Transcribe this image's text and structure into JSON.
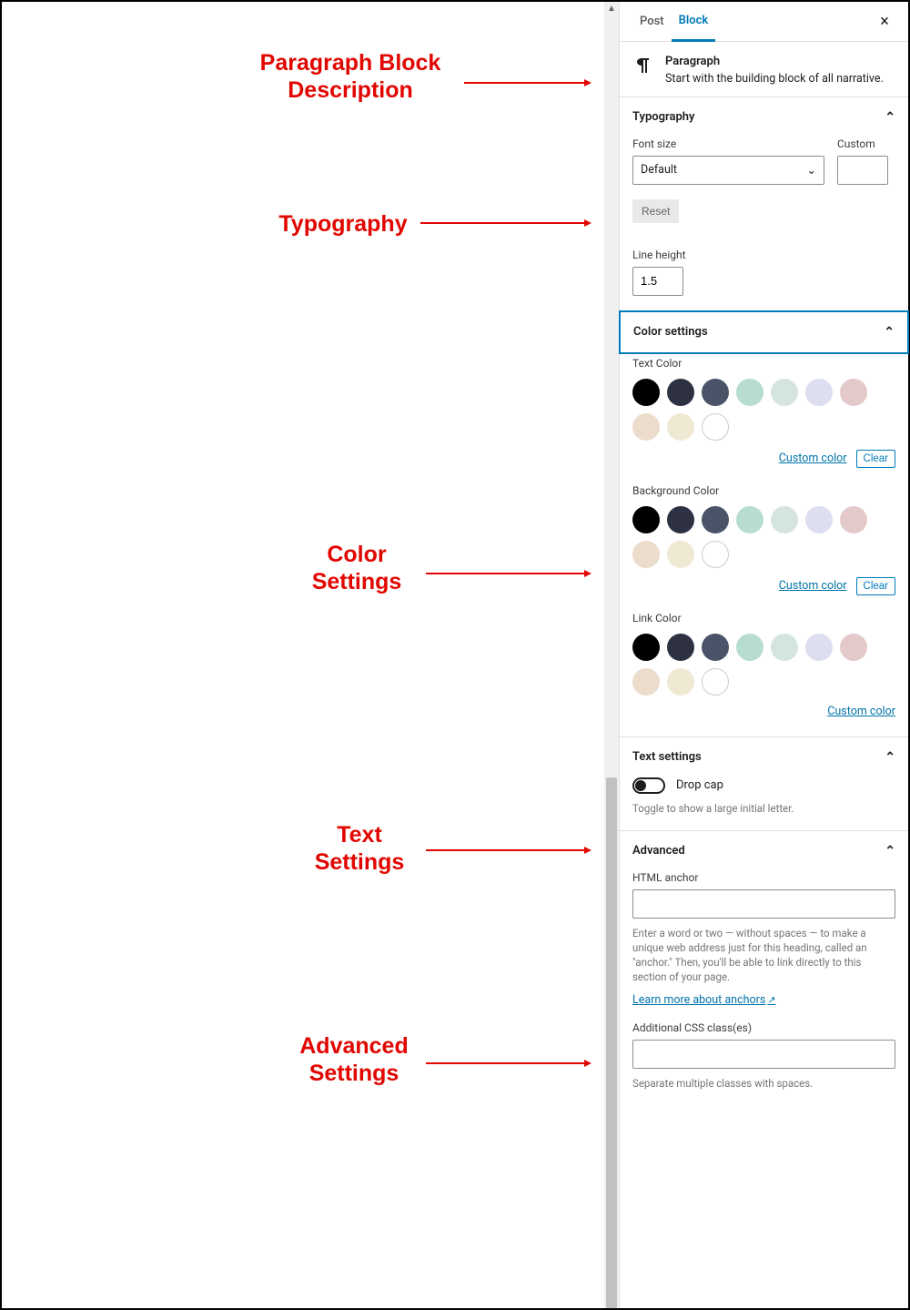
{
  "tabs": {
    "post": "Post",
    "block": "Block",
    "active": "block"
  },
  "block_desc": {
    "title": "Paragraph",
    "text": "Start with the building block of all narrative."
  },
  "typography": {
    "title": "Typography",
    "font_size_label": "Font size",
    "custom_label": "Custom",
    "font_size_value": "Default",
    "custom_value": "",
    "reset": "Reset",
    "line_height_label": "Line height",
    "line_height_value": "1.5"
  },
  "color": {
    "title": "Color settings",
    "custom": "Custom color",
    "clear": "Clear",
    "groups": [
      {
        "label": "Text Color",
        "has_clear": true
      },
      {
        "label": "Background Color",
        "has_clear": true
      },
      {
        "label": "Link Color",
        "has_clear": false
      }
    ],
    "palette": [
      "#000000",
      "#2d3142",
      "#4a5367",
      "#b7ddd0",
      "#d4e5de",
      "#dddef0",
      "#e4c9cb",
      "#ecdccb",
      "#efe9d4",
      "#ffffff"
    ]
  },
  "text_settings": {
    "title": "Text settings",
    "drop_cap": "Drop cap",
    "help": "Toggle to show a large initial letter."
  },
  "advanced": {
    "title": "Advanced",
    "anchor_label": "HTML anchor",
    "anchor_value": "",
    "anchor_help": "Enter a word or two — without spaces — to make a unique web address just for this heading, called an \"anchor.\" Then, you'll be able to link directly to this section of your page.",
    "anchor_link": "Learn more about anchors",
    "css_label": "Additional CSS class(es)",
    "css_value": "",
    "css_help": "Separate multiple classes with spaces."
  },
  "callouts": {
    "desc": "Paragraph Block Description",
    "typo": "Typography",
    "color": "Color Settings",
    "text": "Text Settings",
    "adv": "Advanced Settings"
  }
}
